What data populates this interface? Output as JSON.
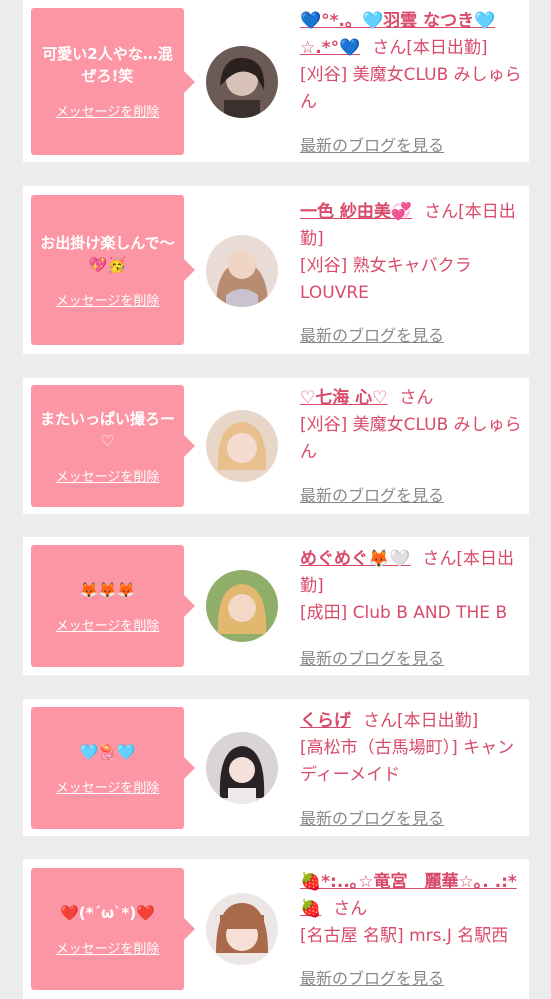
{
  "colors": {
    "accent": "#fd96a4",
    "name": "#d94a6a",
    "link": "#888888"
  },
  "delete_label": "メッセージを削除",
  "blog_label": "最新のブログを見る",
  "entries": [
    {
      "message": "可愛い2人やな…混ぜろ!笑",
      "name": "💙°*.。🩵羽雲 なつき🩵☆.*°💙",
      "san": "さん",
      "status": "[本日出勤]",
      "shop": "[刈谷] 美魔女CLUB みしゅらん"
    },
    {
      "message": "お出掛け楽しんで〜💖🥳",
      "name": "一色 紗由美💞",
      "san": "さん",
      "status": "[本日出勤]",
      "shop": "[刈谷] 熟女キャバクラ LOUVRE"
    },
    {
      "message": "またいっぱい撮ろー♡",
      "name": "♡七海 心♡",
      "san": "さん",
      "status": "",
      "shop": "[刈谷] 美魔女CLUB みしゅらん"
    },
    {
      "message": "🦊🦊🦊",
      "name": "めぐめぐ🦊🤍",
      "san": "さん",
      "status": "[本日出勤]",
      "shop": "[成田] Club B AND THE B"
    },
    {
      "message": "🩵🪼🩵",
      "name": "くらげ",
      "san": "さん",
      "status": "[本日出勤]",
      "shop": "[高松市（古馬場町）] キャンディーメイド"
    },
    {
      "message": "❤️(*´ω`*)❤️",
      "name": "🍓*:..｡☆竜宮　麗華☆｡. .:*🍓",
      "san": "さん",
      "status": "",
      "shop": "[名古屋 名駅] mrs.J 名駅西"
    }
  ]
}
